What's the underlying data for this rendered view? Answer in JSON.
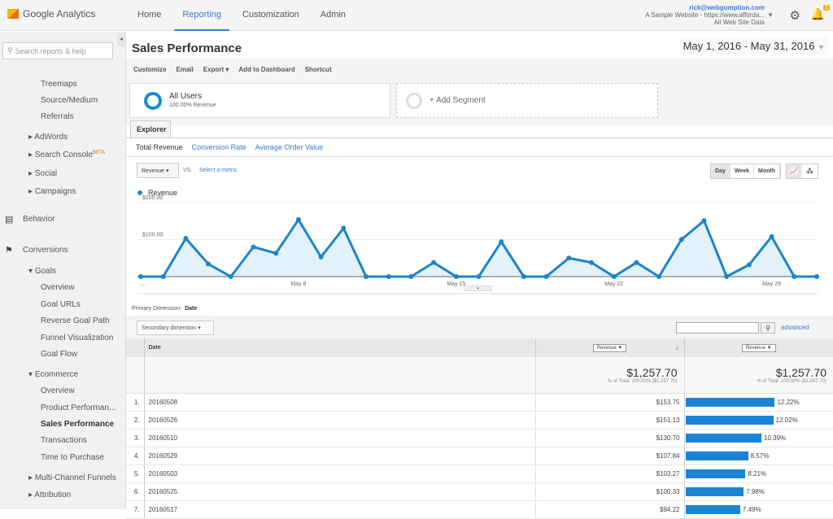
{
  "header": {
    "app_name": "Google Analytics",
    "nav": [
      "Home",
      "Reporting",
      "Customization",
      "Admin"
    ],
    "active_nav": "Reporting",
    "account_email": "rick@webgumption.com",
    "account_property": "A Sample Website - https://www.afforda...",
    "account_view": "All Web Site Data",
    "notification_count": "1"
  },
  "sidebar": {
    "search_placeholder": "Search reports & help",
    "items": [
      {
        "label": "Treemaps",
        "level": 3
      },
      {
        "label": "Source/Medium",
        "level": 3
      },
      {
        "label": "Referrals",
        "level": 3
      },
      {
        "label": "AdWords",
        "level": 2,
        "collapsed": true
      },
      {
        "label": "Search Console",
        "level": 2,
        "collapsed": true,
        "badge": "BETA"
      },
      {
        "label": "Social",
        "level": 2,
        "collapsed": true
      },
      {
        "label": "Campaigns",
        "level": 2,
        "collapsed": true
      },
      {
        "label": "Behavior",
        "level": 1,
        "icon": "behavior-icon"
      },
      {
        "label": "Conversions",
        "level": 1,
        "icon": "flag-icon"
      },
      {
        "label": "Goals",
        "level": 2,
        "expanded": true
      },
      {
        "label": "Overview",
        "level": 3
      },
      {
        "label": "Goal URLs",
        "level": 3
      },
      {
        "label": "Reverse Goal Path",
        "level": 3
      },
      {
        "label": "Funnel Visualization",
        "level": 3
      },
      {
        "label": "Goal Flow",
        "level": 3
      },
      {
        "label": "Ecommerce",
        "level": 2,
        "expanded": true
      },
      {
        "label": "Overview",
        "level": 3
      },
      {
        "label": "Product Performan...",
        "level": 3
      },
      {
        "label": "Sales Performance",
        "level": 3,
        "active": true
      },
      {
        "label": "Transactions",
        "level": 3
      },
      {
        "label": "Time to Purchase",
        "level": 3
      },
      {
        "label": "Multi-Channel Funnels",
        "level": 2,
        "collapsed": true
      },
      {
        "label": "Attribution",
        "level": 2,
        "collapsed": true
      }
    ]
  },
  "page": {
    "title": "Sales Performance",
    "date_range": "May 1, 2016 - May 31, 2016",
    "toolbar": [
      "Customize",
      "Email",
      "Export ▾",
      "Add to Dashboard",
      "Shortcut"
    ],
    "segment": {
      "name": "All Users",
      "sub": "100.00% Revenue"
    },
    "add_segment": "+ Add Segment",
    "tab": "Explorer",
    "subtabs": [
      "Total Revenue",
      "Conversion Rate",
      "Average Order Value"
    ],
    "metric_select": "Revenue",
    "vs": "VS.",
    "select_metric": "Select a metric",
    "granularity": [
      "Day",
      "Week",
      "Month"
    ],
    "active_granularity": "Day",
    "primary_dimension_label": "Primary Dimension:",
    "primary_dimension": "Date",
    "secondary_dimension": "Secondary dimension",
    "advanced": "advanced"
  },
  "chart_data": {
    "type": "area",
    "series": [
      {
        "name": "Revenue",
        "color": "#1a8ad4",
        "values": [
          0,
          0,
          103.27,
          34,
          0,
          80,
          63,
          153.75,
          53,
          130.7,
          0,
          0,
          0,
          38,
          0,
          0,
          94.22,
          0,
          0,
          50,
          38,
          0,
          38,
          0,
          100.33,
          151.13,
          0,
          32,
          107.84,
          0,
          0
        ]
      }
    ],
    "x": [
      "May 1",
      "May 2",
      "May 3",
      "May 4",
      "May 5",
      "May 6",
      "May 7",
      "May 8",
      "May 9",
      "May 10",
      "May 11",
      "May 12",
      "May 13",
      "May 14",
      "May 15",
      "May 16",
      "May 17",
      "May 18",
      "May 19",
      "May 20",
      "May 21",
      "May 22",
      "May 23",
      "May 24",
      "May 25",
      "May 26",
      "May 27",
      "May 28",
      "May 29",
      "May 30",
      "May 31"
    ],
    "x_tick_labels": [
      "...",
      "May 8",
      "May 15",
      "May 22",
      "May 29"
    ],
    "y_tick_labels": [
      "$100.00",
      "$200.00"
    ],
    "ylim": [
      0,
      200
    ],
    "grid": true,
    "legend": "top-left"
  },
  "table": {
    "col_date": "Date",
    "col_rev_select": "Revenue ▼",
    "col_contrib_select": "Revenue ▼",
    "total": "$1,257.70",
    "total_sub": "% of Total: 100.00% ($1,257.70)",
    "rows": [
      {
        "idx": "1.",
        "date": "20160508",
        "revenue": "$153.75",
        "pct": "12.22%",
        "share": 12.22
      },
      {
        "idx": "2.",
        "date": "20160526",
        "revenue": "$151.13",
        "pct": "12.02%",
        "share": 12.02
      },
      {
        "idx": "3.",
        "date": "20160510",
        "revenue": "$130.70",
        "pct": "10.39%",
        "share": 10.39
      },
      {
        "idx": "4.",
        "date": "20160529",
        "revenue": "$107.84",
        "pct": "8.57%",
        "share": 8.57
      },
      {
        "idx": "5.",
        "date": "20160503",
        "revenue": "$103.27",
        "pct": "8.21%",
        "share": 8.21
      },
      {
        "idx": "6.",
        "date": "20160525",
        "revenue": "$100.33",
        "pct": "7.98%",
        "share": 7.98
      },
      {
        "idx": "7.",
        "date": "20160517",
        "revenue": "$94.22",
        "pct": "7.49%",
        "share": 7.49
      }
    ]
  }
}
